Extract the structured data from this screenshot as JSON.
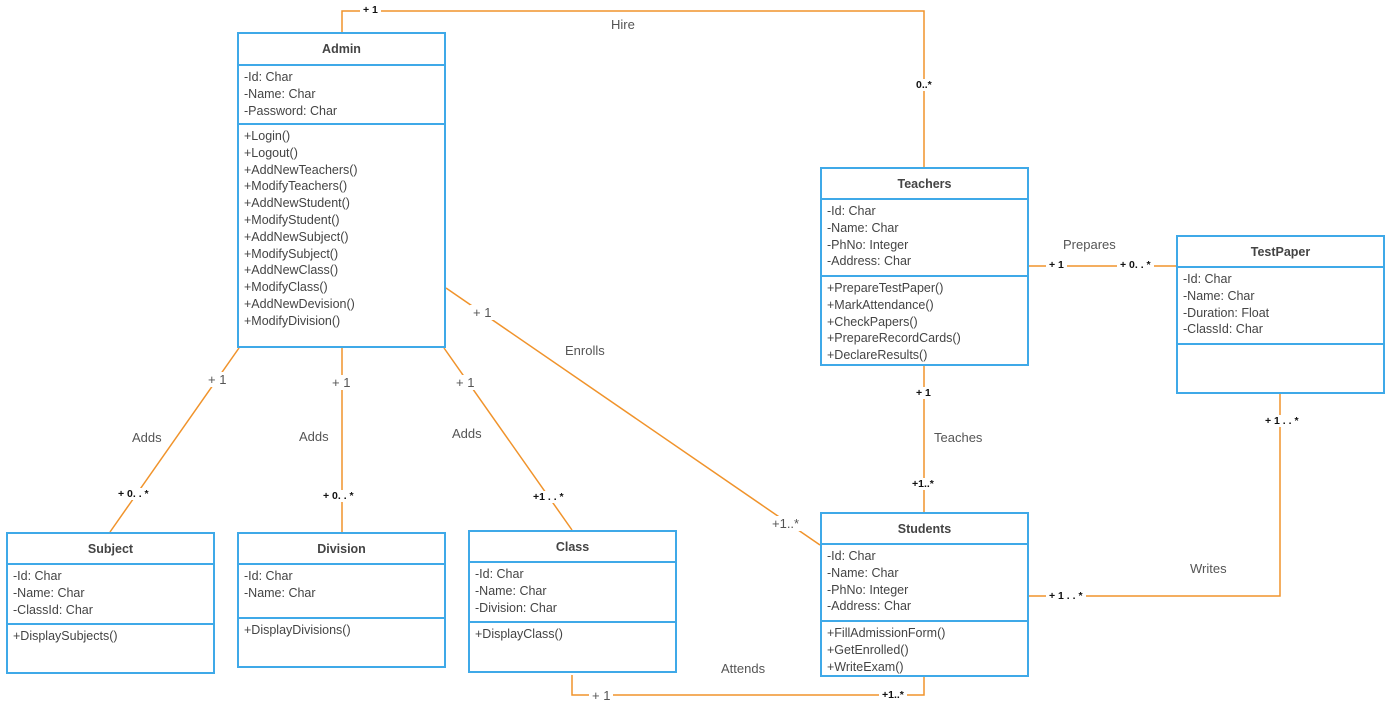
{
  "classes": {
    "admin": {
      "name": "Admin",
      "attributes": [
        "-Id: Char",
        "-Name: Char",
        "-Password: Char"
      ],
      "methods": [
        "+Login()",
        "+Logout()",
        "+AddNewTeachers()",
        "+ModifyTeachers()",
        "+AddNewStudent()",
        "+ModifyStudent()",
        "+AddNewSubject()",
        "+ModifySubject()",
        "+AddNewClass()",
        "+ModifyClass()",
        "+AddNewDevision()",
        "+ModifyDivision()"
      ]
    },
    "teachers": {
      "name": "Teachers",
      "attributes": [
        "-Id: Char",
        "-Name: Char",
        "-PhNo: Integer",
        "-Address: Char"
      ],
      "methods": [
        "+PrepareTestPaper()",
        "+MarkAttendance()",
        "+CheckPapers()",
        "+PrepareRecordCards()",
        "+DeclareResults()"
      ]
    },
    "testpaper": {
      "name": "TestPaper",
      "attributes": [
        "-Id: Char",
        "-Name: Char",
        "-Duration: Float",
        "-ClassId: Char"
      ],
      "methods": []
    },
    "students": {
      "name": "Students",
      "attributes": [
        "-Id: Char",
        "-Name: Char",
        "-PhNo: Integer",
        "-Address: Char"
      ],
      "methods": [
        "+FillAdmissionForm()",
        "+GetEnrolled()",
        "+WriteExam()"
      ]
    },
    "subject": {
      "name": "Subject",
      "attributes": [
        "-Id: Char",
        "-Name: Char",
        "-ClassId: Char"
      ],
      "methods": [
        "+DisplaySubjects()"
      ]
    },
    "division": {
      "name": "Division",
      "attributes": [
        "-Id: Char",
        "-Name: Char"
      ],
      "methods": [
        "+DisplayDivisions()"
      ]
    },
    "class": {
      "name": "Class",
      "attributes": [
        "-Id: Char",
        "-Name: Char",
        "-Division: Char"
      ],
      "methods": [
        "+DisplayClass()"
      ]
    }
  },
  "associations": {
    "hire": {
      "label": "Hire",
      "from": "Admin",
      "to": "Teachers",
      "from_mult": "+ 1",
      "to_mult": "0..*"
    },
    "prepares": {
      "label": "Prepares",
      "from": "Teachers",
      "to": "TestPaper",
      "from_mult": "+ 1",
      "to_mult": "+ 0. . *"
    },
    "adds_subject": {
      "label": "Adds",
      "from": "Admin",
      "to": "Subject",
      "from_mult": "+ 1",
      "to_mult": "+ 0. . *"
    },
    "adds_division": {
      "label": "Adds",
      "from": "Admin",
      "to": "Division",
      "from_mult": "+ 1",
      "to_mult": "+ 0. . *"
    },
    "adds_class": {
      "label": "Adds",
      "from": "Admin",
      "to": "Class",
      "from_mult": "+ 1",
      "to_mult": "+1 . . *"
    },
    "enrolls": {
      "label": "Enrolls",
      "from": "Admin",
      "to": "Students",
      "from_mult": "+ 1",
      "to_mult": "+1..*"
    },
    "teaches": {
      "label": "Teaches",
      "from": "Teachers",
      "to": "Students",
      "from_mult": "+ 1",
      "to_mult": "+1..*"
    },
    "writes": {
      "label": "Writes",
      "from": "Students",
      "to": "TestPaper",
      "from_mult": "+ 1 . . *",
      "to_mult": "+ 1 . . *"
    },
    "attends": {
      "label": "Attends",
      "from": "Class",
      "to": "Students",
      "from_mult": "+ 1",
      "to_mult": "+1..*"
    }
  },
  "colors": {
    "class_border": "#3fa9e8",
    "association_line": "#f0932b",
    "text": "#444444"
  }
}
